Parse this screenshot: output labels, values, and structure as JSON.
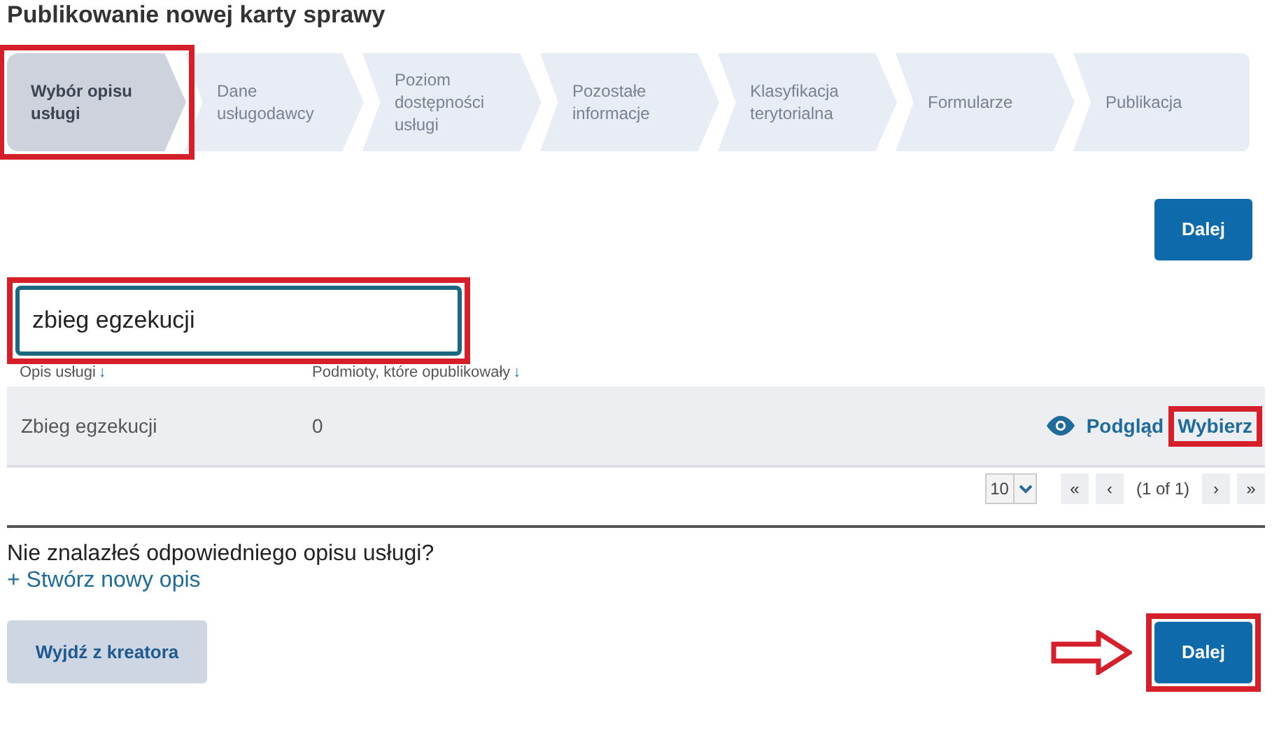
{
  "page_title": "Publikowanie nowej karty sprawy",
  "steps": [
    {
      "label": "Wybór opisu usługi",
      "selected": true,
      "highlighted": true
    },
    {
      "label": "Dane usługodawcy",
      "selected": false,
      "highlighted": false
    },
    {
      "label": "Poziom dostępności usługi",
      "selected": false,
      "highlighted": false
    },
    {
      "label": "Pozostałe informacje",
      "selected": false,
      "highlighted": false
    },
    {
      "label": "Klasyfikacja terytorialna",
      "selected": false,
      "highlighted": false
    },
    {
      "label": "Formularze",
      "selected": false,
      "highlighted": false
    },
    {
      "label": "Publikacja",
      "selected": false,
      "highlighted": false
    }
  ],
  "top_button": {
    "label": "Dalej"
  },
  "search": {
    "value": "zbieg egzekucji",
    "highlighted": true
  },
  "table": {
    "columns": [
      {
        "label": "Opis usługi",
        "sort": "↓"
      },
      {
        "label": "Podmioty, które opublikowały",
        "sort": "↓"
      }
    ],
    "rows": [
      {
        "cells": [
          "Zbieg egzekucji",
          "0"
        ],
        "actions": [
          {
            "label": "Podgląd",
            "kind": "preview",
            "highlighted": false
          },
          {
            "label": "Wybierz",
            "kind": "select",
            "highlighted": true
          }
        ]
      }
    ]
  },
  "pagination": {
    "page_size": "10",
    "first": "«",
    "prev": "‹",
    "status": "(1 of 1)",
    "next": "›",
    "last": "»"
  },
  "prompt": "Nie znalazłeś odpowiedniego opisu usługi?",
  "create_link": "+ Stwórz nowy opis",
  "footer": {
    "exit_button": "Wyjdź z kreatora",
    "next_button": "Dalej",
    "next_highlighted": true
  }
}
